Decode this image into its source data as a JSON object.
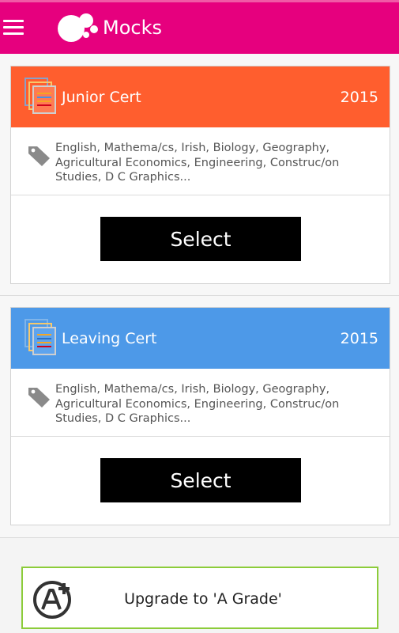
{
  "app_bar": {
    "title": "Mocks",
    "menu_icon": "hamburger-menu-icon",
    "logo_icon": "bubbles-logo-icon",
    "color": "#e6007e"
  },
  "cards": [
    {
      "title": "Junior Cert",
      "year": "2015",
      "header_color": "#ff5e2e",
      "header_icon": "documents-stack-icon",
      "tag_icon": "tag-icon",
      "subjects": "English, Mathema/cs, Irish, Biology, Geography, Agricultural Economics, Engineering, Construc/on Studies, D C Graphics...",
      "button_label": "Select"
    },
    {
      "title": "Leaving Cert",
      "year": "2015",
      "header_color": "#4d99e8",
      "header_icon": "documents-stack-icon",
      "tag_icon": "tag-icon",
      "subjects": "English, Mathema/cs, Irish, Biology, Geography, Agricultural Economics, Engineering, Construc/on Studies, D C Graphics...",
      "button_label": "Select"
    }
  ],
  "upgrade": {
    "label": "Upgrade to 'A Grade'",
    "icon": "a-plus-grade-icon",
    "border_color": "#8ccc3a"
  }
}
